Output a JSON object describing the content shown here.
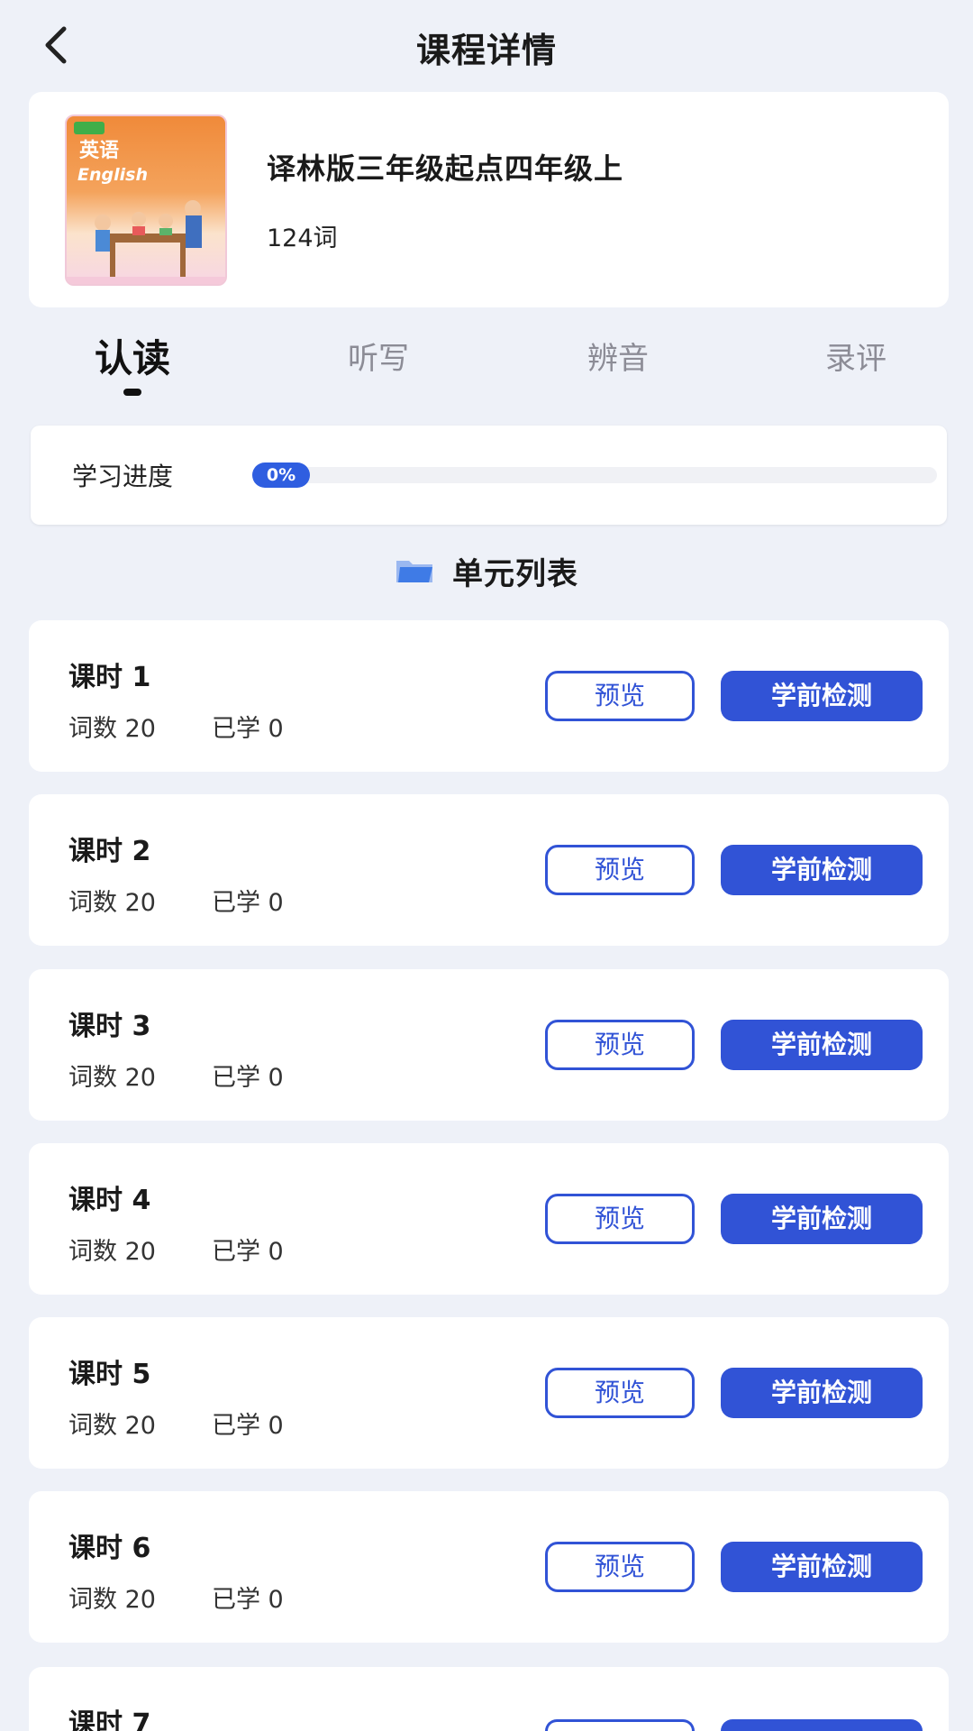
{
  "header": {
    "title": "课程详情"
  },
  "course": {
    "cover_title": "英语",
    "cover_subtitle": "English",
    "name": "译林版三年级起点四年级上",
    "word_count": "124词"
  },
  "tabs": [
    {
      "label": "认读",
      "active": true
    },
    {
      "label": "听写",
      "active": false
    },
    {
      "label": "辨音",
      "active": false
    },
    {
      "label": "录评",
      "active": false
    }
  ],
  "progress": {
    "label": "学习进度",
    "percent_text": "0%",
    "value": 0
  },
  "section": {
    "title": "单元列表"
  },
  "lessons": [
    {
      "title": "课时 1",
      "words": "词数 20",
      "learned": "已学 0",
      "preview_label": "预览",
      "test_label": "学前检测"
    },
    {
      "title": "课时 2",
      "words": "词数 20",
      "learned": "已学 0",
      "preview_label": "预览",
      "test_label": "学前检测"
    },
    {
      "title": "课时 3",
      "words": "词数 20",
      "learned": "已学 0",
      "preview_label": "预览",
      "test_label": "学前检测"
    },
    {
      "title": "课时 4",
      "words": "词数 20",
      "learned": "已学 0",
      "preview_label": "预览",
      "test_label": "学前检测"
    },
    {
      "title": "课时 5",
      "words": "词数 20",
      "learned": "已学 0",
      "preview_label": "预览",
      "test_label": "学前检测"
    },
    {
      "title": "课时 6",
      "words": "词数 20",
      "learned": "已学 0",
      "preview_label": "预览",
      "test_label": "学前检测"
    },
    {
      "title": "课时 7"
    }
  ],
  "colors": {
    "accent": "#3153d6",
    "background": "#eef1f8",
    "progress_badge": "#2f5ee0"
  },
  "icons": {
    "back": "chevron-left-icon",
    "section": "folder-icon"
  }
}
